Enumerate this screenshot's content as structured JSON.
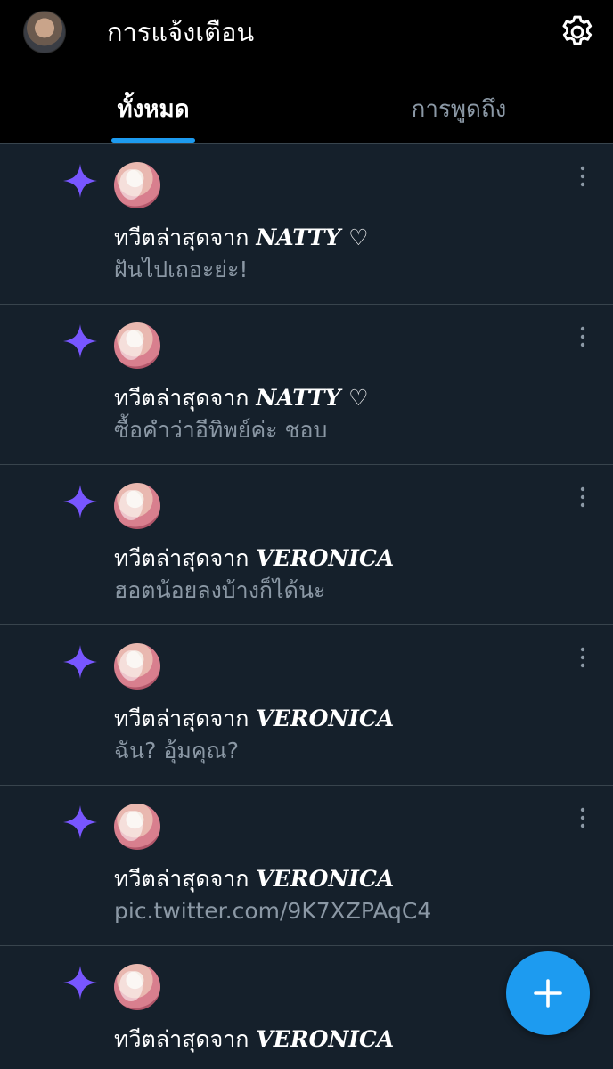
{
  "header": {
    "title": "การแจ้งเตือน"
  },
  "tabs": [
    {
      "label": "ทั้งหมด",
      "selected": true
    },
    {
      "label": "การพูดถึง",
      "selected": false
    }
  ],
  "colors": {
    "background": "#15202b",
    "header_background": "#000000",
    "accent": "#1d9bf0",
    "sparkle": "#7856ff",
    "secondary_text": "#8b98a5",
    "divider": "#38444d"
  },
  "icons": {
    "avatar": "profile-avatar",
    "settings": "gear-icon",
    "notification_type": "sparkle-icon",
    "more": "more-vertical-icon",
    "compose": "plus-icon"
  },
  "notifications": [
    {
      "prefix": "ทวีตล่าสุดจาก",
      "name": "NATTY ♡",
      "text": "ฝันไปเถอะย่ะ!"
    },
    {
      "prefix": "ทวีตล่าสุดจาก",
      "name": "NATTY ♡",
      "text": "ซื้อคำว่าอีทิพย์ค่ะ ชอบ"
    },
    {
      "prefix": "ทวีตล่าสุดจาก",
      "name": "VERONICA",
      "text": "ฮอตน้อยลงบ้างก็ได้นะ"
    },
    {
      "prefix": "ทวีตล่าสุดจาก",
      "name": "VERONICA",
      "text": "ฉัน? อุ้มคุณ?"
    },
    {
      "prefix": "ทวีตล่าสุดจาก",
      "name": "VERONICA",
      "text": "pic.twitter.com/9K7XZPAqC4"
    },
    {
      "prefix": "ทวีตล่าสุดจาก",
      "name": "VERONICA",
      "text": ""
    }
  ]
}
